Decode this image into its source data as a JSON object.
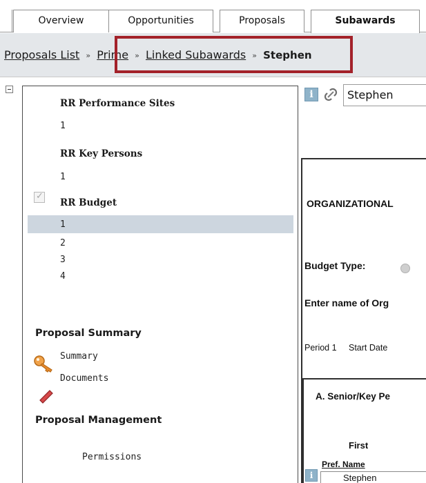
{
  "tabs": [
    {
      "label": "Overview",
      "active": false
    },
    {
      "label": "Opportunities",
      "active": false
    },
    {
      "label": "Proposals",
      "active": false
    },
    {
      "label": "Subawards",
      "active": true
    }
  ],
  "breadcrumb": {
    "items": [
      "Proposals List",
      "Prime",
      "Linked Subawards"
    ],
    "separator": "»",
    "current": "Stephen"
  },
  "tree": {
    "rr_performance_sites": {
      "label": "RR Performance Sites",
      "items": [
        "1"
      ]
    },
    "rr_key_persons": {
      "label": "RR Key Persons",
      "items": [
        "1"
      ]
    },
    "rr_budget": {
      "label": "RR Budget",
      "checked": true,
      "items": [
        "1",
        "2",
        "3",
        "4"
      ],
      "selected": "1"
    },
    "proposal_summary": {
      "label": "Proposal Summary",
      "items": [
        "Summary",
        "Documents"
      ]
    },
    "proposal_management": {
      "label": "Proposal Management",
      "items": [
        "Permissions"
      ]
    }
  },
  "detail": {
    "title_value": "Stephen",
    "org_heading": "ORGANIZATIONAL",
    "budget_type_label": "Budget Type:",
    "enter_name_label": "Enter name of Org",
    "period_label": "Period 1",
    "start_date_label": "Start Date",
    "section_a_label": "A. Senior/Key Pe",
    "col_first": "First",
    "col_pref_name": "Pref. Name",
    "first_name_value": "Stephen"
  },
  "colors": {
    "highlight_border": "#a3222a",
    "breadcrumb_bg": "#e4e7ea",
    "selected_row_bg": "#cdd6df",
    "info_icon_bg": "#8fb3c9"
  }
}
